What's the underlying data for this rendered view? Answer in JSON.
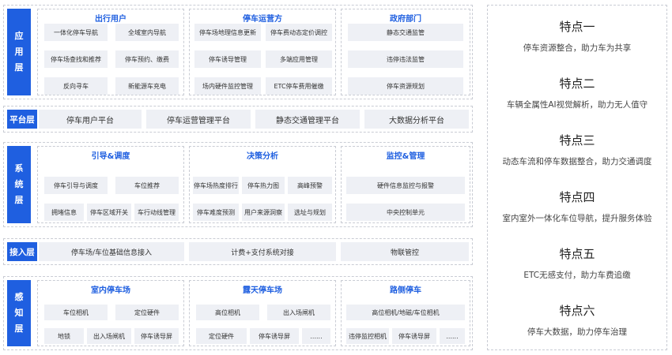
{
  "app": {
    "label": "应用层",
    "chars": [
      "应",
      "用",
      "层"
    ],
    "groups": [
      {
        "title": "出行用户",
        "items": [
          "一体化停车导航",
          "全域室内导航",
          "停车场查找和推荐",
          "停车预约、缴费",
          "反向寻车",
          "新能源车充电"
        ]
      },
      {
        "title": "停车运营方",
        "items": [
          "停车场地理信息更新",
          "停车费动态定价调控",
          "停车诱导管理",
          "多端应用管理",
          "场内硬件监控管理",
          "ETC停车费用催缴"
        ]
      },
      {
        "title": "政府部门",
        "items": [
          "静态交通监管",
          "违停违法监管",
          "停车资源规划"
        ]
      }
    ]
  },
  "platform": {
    "label": "平台层",
    "items": [
      "停车用户平台",
      "停车运营管理平台",
      "静态交通管理平台",
      "大数据分析平台"
    ]
  },
  "system": {
    "label": "系统层",
    "chars": [
      "系",
      "统",
      "层"
    ],
    "groups": [
      {
        "title": "引导&调度",
        "items": [
          "停车引导与调度",
          "车位推荐",
          "拥堵信息",
          "停车区域开关",
          "车行动线管理"
        ]
      },
      {
        "title": "决策分析",
        "items": [
          "停车场热度排行",
          "停车热力图",
          "高峰预警",
          "停车难度预测",
          "用户来源洞察",
          "选址与规划"
        ]
      },
      {
        "title": "监控&管理",
        "items": [
          "硬件信息监控与报警",
          "中央控制单元"
        ]
      }
    ]
  },
  "access": {
    "label": "接入层",
    "items": [
      "停车场/车位基础信息接入",
      "计费+支付系统对接",
      "物联管控"
    ]
  },
  "perception": {
    "label": "感知层",
    "chars": [
      "感",
      "知",
      "层"
    ],
    "groups": [
      {
        "title": "室内停车场",
        "items": [
          "车位相机",
          "定位硬件",
          "地锁",
          "出入场闸机",
          "停车诱导屏"
        ]
      },
      {
        "title": "露天停车场",
        "items": [
          "高位相机",
          "出入场闸机",
          "定位硬件",
          "停车诱导屏",
          "......"
        ]
      },
      {
        "title": "路侧停车",
        "items": [
          "高位相机/地磁/车位相机",
          "违停监控相机",
          "停车诱导屏",
          "......"
        ]
      }
    ]
  },
  "features": [
    {
      "title": "特点一",
      "desc": "停车资源整合，助力车为共享"
    },
    {
      "title": "特点二",
      "desc": "车辆全属性AI视觉解析，助力无人值守"
    },
    {
      "title": "特点三",
      "desc": "动态车流和停车数据整合，助力交通调度"
    },
    {
      "title": "特点四",
      "desc": "室内室外一体化车位导航，提升服务体验"
    },
    {
      "title": "特点五",
      "desc": "ETC无感支付，助力车费追缴"
    },
    {
      "title": "特点六",
      "desc": "停车大数据，助力停车治理"
    }
  ]
}
